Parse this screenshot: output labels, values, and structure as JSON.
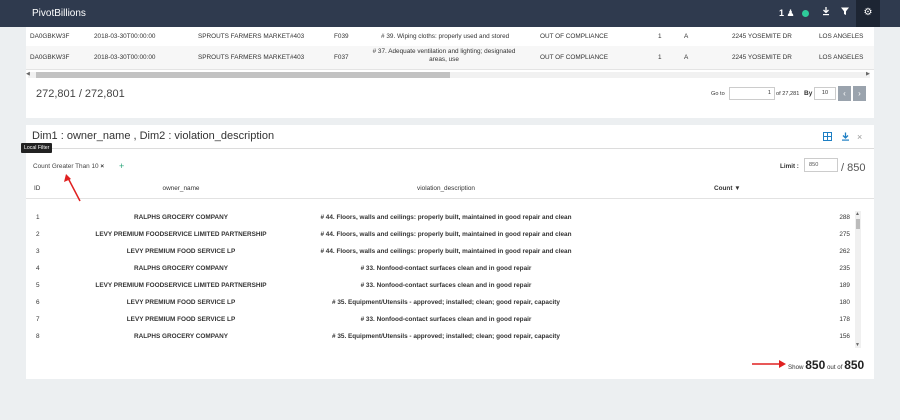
{
  "topbar": {
    "brand": "PivotBillions",
    "users_count": "1",
    "users_icon": "user-icon",
    "icons": [
      "download-icon",
      "filter-icon",
      "gear-icon"
    ]
  },
  "data_panel": {
    "rows": [
      [
        "DA0GBKW3F",
        "2018-03-30T00:00:00",
        "SPROUTS FARMERS MARKET#403",
        "F039",
        "# 39. Wiping cloths: properly used and stored",
        "OUT OF COMPLIANCE",
        "1",
        "A",
        "2245 YOSEMITE DR",
        "LOS ANGELES"
      ],
      [
        "DA0GBKW3F",
        "2018-03-30T00:00:00",
        "SPROUTS FARMERS MARKET#403",
        "F037",
        "# 37. Adequate ventilation and lighting; designated areas, use",
        "OUT OF COMPLIANCE",
        "1",
        "A",
        "2245 YOSEMITE DR",
        "LOS ANGELES"
      ]
    ],
    "record_count": "272,801 / 272,801",
    "goto_label": "Go to",
    "goto_value": "1",
    "of_label": "of 27,281",
    "by_label": "By",
    "by_value": "10",
    "prev_label": "‹",
    "next_label": "›"
  },
  "pivot_panel": {
    "title": "Dim1 : owner_name , Dim2 : violation_description",
    "filter_chip": "Count Greater Than 10",
    "filter_remove": "×",
    "add_filter": "+",
    "tooltip": "Local Filter",
    "limit_label": "Limit :",
    "limit_placeholder": "850",
    "limit_total": "/ 850",
    "columns": {
      "id": "ID",
      "owner": "owner_name",
      "violation": "violation_description",
      "count": "Count"
    },
    "rows": [
      {
        "id": "1",
        "owner": "RALPHS GROCERY COMPANY",
        "violation": "# 44. Floors, walls and ceilings: properly built, maintained in good repair and clean",
        "count": "288"
      },
      {
        "id": "2",
        "owner": "LEVY PREMIUM FOODSERVICE LIMITED PARTNERSHIP",
        "violation": "# 44. Floors, walls and ceilings: properly built, maintained in good repair and clean",
        "count": "275"
      },
      {
        "id": "3",
        "owner": "LEVY PREMIUM FOOD SERVICE LP",
        "violation": "# 44. Floors, walls and ceilings: properly built, maintained in good repair and clean",
        "count": "262"
      },
      {
        "id": "4",
        "owner": "RALPHS GROCERY COMPANY",
        "violation": "# 33. Nonfood-contact surfaces clean and in good repair",
        "count": "235"
      },
      {
        "id": "5",
        "owner": "LEVY PREMIUM FOODSERVICE LIMITED PARTNERSHIP",
        "violation": "# 33. Nonfood-contact surfaces clean and in good repair",
        "count": "189"
      },
      {
        "id": "6",
        "owner": "LEVY PREMIUM FOOD SERVICE LP",
        "violation": "# 35. Equipment/Utensils - approved; installed; clean; good repair, capacity",
        "count": "180"
      },
      {
        "id": "7",
        "owner": "LEVY PREMIUM FOOD SERVICE LP",
        "violation": "# 33. Nonfood-contact surfaces clean and in good repair",
        "count": "178"
      },
      {
        "id": "8",
        "owner": "RALPHS GROCERY COMPANY",
        "violation": "# 35. Equipment/Utensils - approved; installed; clean; good repair, capacity",
        "count": "156"
      }
    ],
    "show_prefix": "Show",
    "show_value": "850",
    "show_mid": "out of",
    "show_total": "850"
  },
  "colors": {
    "topbar": "#2f3a4e",
    "accent": "#1e7fc4",
    "annotation_arrow": "#e02020",
    "status_dot": "#2ecc9a"
  }
}
